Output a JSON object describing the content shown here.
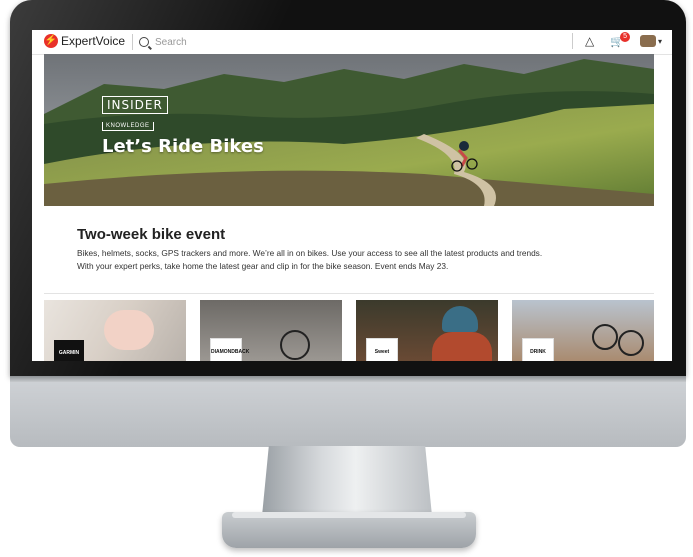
{
  "nav": {
    "logo_text": "ExpertVoice",
    "search_placeholder": "Search",
    "cart_count": "5"
  },
  "hero": {
    "badge_top": "INSIDER",
    "badge_bottom": "KNOWLEDGE",
    "title": "Let’s Ride Bikes"
  },
  "event": {
    "title": "Two-week bike event",
    "line1": "Bikes, helmets, socks, GPS trackers and more. We’re all in on bikes. Use your access to see all the latest products and trends.",
    "line2": "With your expert perks, take home the latest gear and clip in for the bike season. Event ends May 23."
  },
  "cards": [
    {
      "brand": "GARMIN"
    },
    {
      "brand": "DIAMONDBACK"
    },
    {
      "brand": "Sweet Protection"
    },
    {
      "brand": "DRINK COFFEE"
    }
  ],
  "colors": {
    "accent": "#e8302a",
    "bezel": "#111111"
  }
}
